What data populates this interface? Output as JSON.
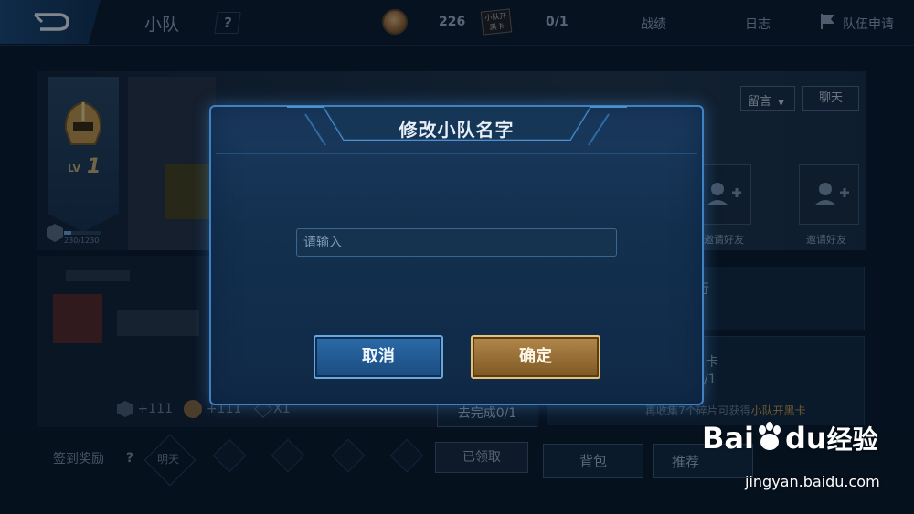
{
  "header": {
    "title": "小队",
    "help": "?",
    "coins": "226",
    "card_icon_text": "小队开黑卡",
    "card_count": "0/1",
    "links": [
      "战绩",
      "日志",
      "队伍申请"
    ]
  },
  "team": {
    "level_prefix": "LV",
    "level": "1",
    "exp_text": "230/1230",
    "exp_progress": 0.19,
    "message_select": "留言",
    "chat": "聊天",
    "invite_label": "邀请好友"
  },
  "left_card": {
    "reward_exp": "+111",
    "reward_coin": "+111",
    "reward_x": "X1",
    "todo": "去完成0/1"
  },
  "right_card": {
    "row1_suffix": "行",
    "row2_suffix": "卡",
    "row2_sub": "/1",
    "note_prefix": "再收集7个碎片可获得",
    "note_highlight": "小队开黑卡"
  },
  "bottom": {
    "sign_reward": "签到奖励",
    "help": "?",
    "tomorrow": "明天",
    "claimed": "已领取",
    "bag": "背包",
    "recommend": "推荐"
  },
  "modal": {
    "title": "修改小队名字",
    "input_value": "",
    "input_placeholder": "请输入",
    "cancel": "取消",
    "confirm": "确定"
  },
  "watermark": {
    "logo_left": "Bai",
    "logo_right": "du",
    "logo_cn": "经验",
    "url": "jingyan.baidu.com"
  },
  "colors": {
    "accent_blue": "#3f82c4",
    "confirm_gold": "#b2874a",
    "highlight_gold": "#c9a14a"
  }
}
